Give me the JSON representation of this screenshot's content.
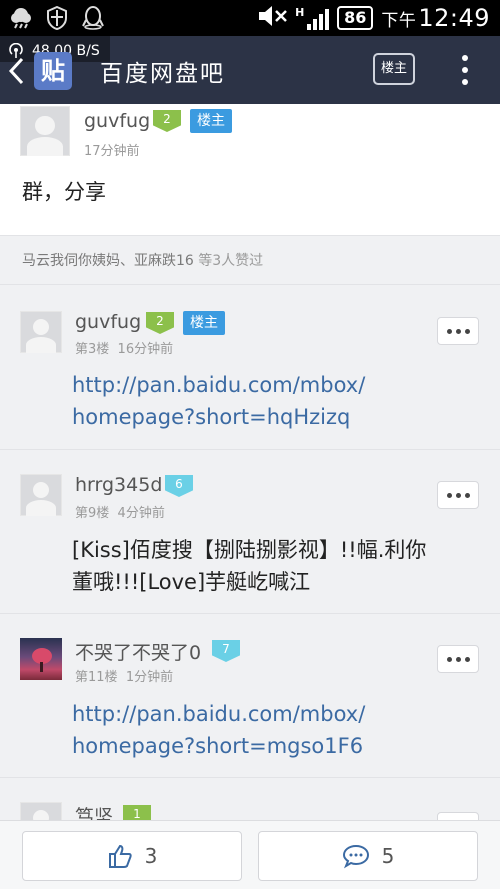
{
  "status_bar": {
    "battery": "86",
    "time_period": "下午",
    "time": "12:49",
    "network_speed": "48.00 B/S",
    "signal_label": "H"
  },
  "nav": {
    "logo_text": "贴",
    "title": "百度网盘吧",
    "owner_button": "楼主"
  },
  "first_post": {
    "username": "guvfug",
    "level": "2",
    "owner_tag": "楼主",
    "time": "17分钟前",
    "content": "群，分享"
  },
  "likes": {
    "names": "马云我伺你姨妈、亚麻跌16",
    "suffix": " 等3人赞过"
  },
  "replies": [
    {
      "username": "guvfug",
      "level": "2",
      "owner_tag": "楼主",
      "floor": "第3楼",
      "time": "16分钟前",
      "content_line1": "http://pan.baidu.com/mbox/",
      "content_line2": "homepage?short=hqHzizq"
    },
    {
      "username": "hrrg345d",
      "level": "6",
      "floor": "第9楼",
      "time": "4分钟前",
      "content_line1": "[Kiss]佰度搜【捌陆捌影视】!!幅.利你",
      "content_line2": "董哦!!![Love]芋艇屹喊江"
    },
    {
      "username": "不哭了不哭了0",
      "level": "7",
      "floor": "第11楼",
      "time": "1分钟前",
      "content_line1": "http://pan.baidu.com/mbox/",
      "content_line2": "homepage?short=mgso1F6"
    },
    {
      "username": "笃坚",
      "level": "1"
    }
  ],
  "bottom_bar": {
    "like_count": "3",
    "comment_count": "5"
  },
  "colors": {
    "nav_bg": "#2c3346",
    "link": "#3b6aa3",
    "owner_tag": "#3b9be0",
    "level_green": "#8cc04b",
    "level_blue": "#6ad0e6"
  }
}
